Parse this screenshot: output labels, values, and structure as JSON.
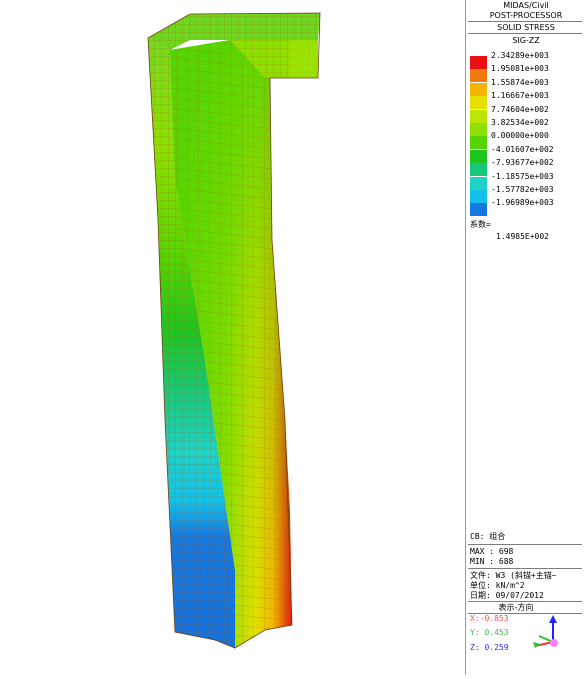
{
  "legend": {
    "app": "MIDAS/Civil",
    "module": "POST-PROCESSOR",
    "result_type": "SOLID STRESS",
    "component": "SIG-ZZ",
    "levels": [
      "2.34289e+003",
      "1.95081e+003",
      "1.55874e+003",
      "1.16667e+003",
      "7.74604e+002",
      "3.82534e+002",
      "0.00000e+000",
      "-4.01607e+002",
      "-7.93677e+002",
      "-1.18575e+003",
      "-1.57782e+003",
      "-1.96989e+003"
    ],
    "colors": [
      "#e81010",
      "#f07a10",
      "#f5b400",
      "#e6e000",
      "#bce600",
      "#8ee000",
      "#56d400",
      "#1ec51e",
      "#18c87a",
      "#1ed2c6",
      "#12c0ea",
      "#1577e0"
    ],
    "factor_label": "系数=",
    "factor_value": "1.4985E+002"
  },
  "info": {
    "cb": "CB: 组合",
    "max": "MAX : 698",
    "min": "MIN : 688",
    "file": "文件: W3 (斜锚+主锚~",
    "unit": "单位:  kN/m^2",
    "date": "日期:  09/07/2012",
    "view_dir_label": "表示-方向",
    "x": "X:-0.853",
    "y": "Y: 0.453",
    "z": "Z: 0.259"
  },
  "axis_colors": {
    "x": "#ff5050",
    "y": "#40c040",
    "z": "#3030ff"
  }
}
